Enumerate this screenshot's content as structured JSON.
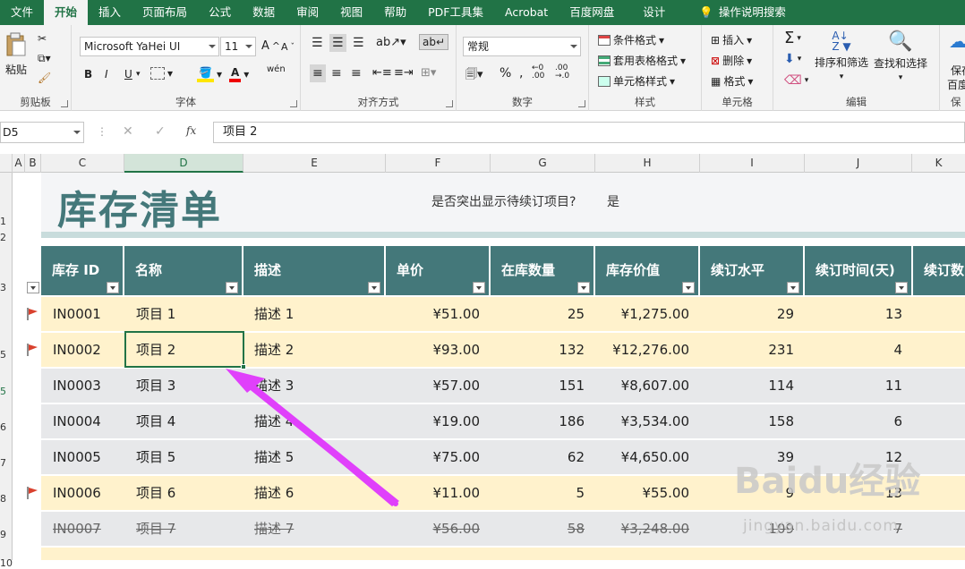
{
  "tabs": [
    "文件",
    "开始",
    "插入",
    "页面布局",
    "公式",
    "数据",
    "审阅",
    "视图",
    "帮助",
    "PDF工具集",
    "Acrobat",
    "百度网盘",
    "设计"
  ],
  "tell_me": "操作说明搜索",
  "ribbon": {
    "clipboard": {
      "label": "剪贴板",
      "paste": "粘贴"
    },
    "font": {
      "label": "字体",
      "family": "Microsoft YaHei UI",
      "size": "11",
      "bold": "B",
      "italic": "I",
      "underline": "U",
      "wen": "wén"
    },
    "align": {
      "label": "对齐方式"
    },
    "number": {
      "label": "数字",
      "format": "常规",
      "percent": "%"
    },
    "styles": {
      "label": "样式",
      "cond": "条件格式",
      "table": "套用表格格式",
      "cell": "单元格样式"
    },
    "cells": {
      "label": "单元格",
      "insert": "插入",
      "delete": "删除",
      "format": "格式"
    },
    "editing": {
      "label": "编辑",
      "sort": "排序和筛选",
      "find": "查找和选择"
    },
    "save": {
      "label": "保",
      "line1": "保存",
      "line2": "百度"
    }
  },
  "formula_bar": {
    "name_box": "D5",
    "formula": "项目 2",
    "fx": "fx"
  },
  "columns": [
    "A",
    "B",
    "C",
    "D",
    "E",
    "F",
    "G",
    "H",
    "I",
    "J",
    "K"
  ],
  "row_numbers": [
    "1",
    "2",
    "3",
    "5",
    "5",
    "6",
    "7",
    "8",
    "9",
    "10"
  ],
  "title": "库存清单",
  "question_label": "是否突出显示待续订项目?",
  "question_value": "是",
  "headers": [
    "库存 ID",
    "名称",
    "描述",
    "单价",
    "在库数量",
    "库存价值",
    "续订水平",
    "续订时间(天)",
    "续订数"
  ],
  "rows": [
    {
      "id": "IN0001",
      "name": "项目 1",
      "desc": "描述 1",
      "price": "¥51.00",
      "qty": "25",
      "value": "¥1,275.00",
      "level": "29",
      "days": "13",
      "flag": true,
      "hl": true,
      "strike": false
    },
    {
      "id": "IN0002",
      "name": "项目 2",
      "desc": "描述 2",
      "price": "¥93.00",
      "qty": "132",
      "value": "¥12,276.00",
      "level": "231",
      "days": "4",
      "flag": true,
      "hl": true,
      "strike": false
    },
    {
      "id": "IN0003",
      "name": "项目 3",
      "desc": "描述 3",
      "price": "¥57.00",
      "qty": "151",
      "value": "¥8,607.00",
      "level": "114",
      "days": "11",
      "flag": false,
      "hl": false,
      "strike": false
    },
    {
      "id": "IN0004",
      "name": "项目 4",
      "desc": "描述 4",
      "price": "¥19.00",
      "qty": "186",
      "value": "¥3,534.00",
      "level": "158",
      "days": "6",
      "flag": false,
      "hl": false,
      "strike": false
    },
    {
      "id": "IN0005",
      "name": "项目 5",
      "desc": "描述 5",
      "price": "¥75.00",
      "qty": "62",
      "value": "¥4,650.00",
      "level": "39",
      "days": "12",
      "flag": false,
      "hl": false,
      "strike": false
    },
    {
      "id": "IN0006",
      "name": "项目 6",
      "desc": "描述 6",
      "price": "¥11.00",
      "qty": "5",
      "value": "¥55.00",
      "level": "9",
      "days": "13",
      "flag": true,
      "hl": true,
      "strike": false
    },
    {
      "id": "IN0007",
      "name": "项目 7",
      "desc": "描述 7",
      "price": "¥56.00",
      "qty": "58",
      "value": "¥3,248.00",
      "level": "109",
      "days": "7",
      "flag": false,
      "hl": false,
      "strike": true
    }
  ],
  "watermark": "Baidu经验",
  "watermark_url": "jingyan.baidu.com",
  "colors": {
    "excel_green": "#217346",
    "header_teal": "#44787a",
    "highlight": "#fff2cc",
    "alt_row": "#e7e8ea",
    "arrow": "#e040fb"
  }
}
